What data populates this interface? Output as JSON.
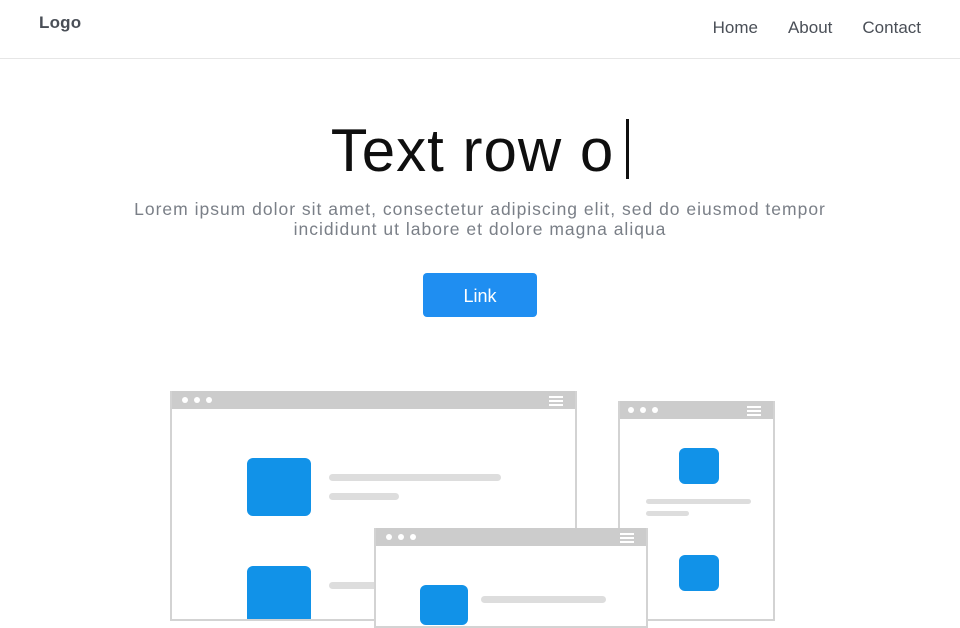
{
  "header": {
    "logo": "Logo",
    "nav": [
      {
        "label": "Home"
      },
      {
        "label": "About"
      },
      {
        "label": "Contact"
      }
    ]
  },
  "hero": {
    "title": "Text row o",
    "subtitle": "Lorem ipsum dolor sit amet, consectetur adipiscing elit, sed do eiusmod tempor incididunt ut labore et dolore magna aliqua",
    "cta_label": "Link"
  },
  "colors": {
    "accent": "#1f8ef1",
    "illustration_blue": "#1192e8",
    "window_bar": "#cccccc",
    "text_muted": "#7a7f87"
  },
  "illustration": {
    "description_icon": "browser-windows-illustration"
  }
}
